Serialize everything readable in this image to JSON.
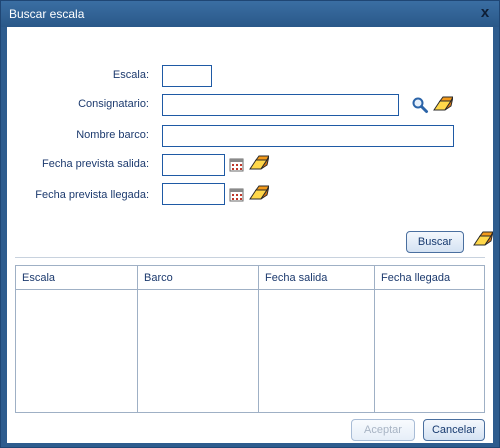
{
  "window": {
    "title": "Buscar escala",
    "close_label": "x"
  },
  "form": {
    "escala_label": "Escala:",
    "escala_value": "",
    "consignatario_label": "Consignatario:",
    "consignatario_value": "",
    "nombre_barco_label": "Nombre barco:",
    "nombre_barco_value": "",
    "fecha_salida_label": "Fecha prevista salida:",
    "fecha_salida_value": "",
    "fecha_llegada_label": "Fecha prevista llegada:",
    "fecha_llegada_value": ""
  },
  "actions": {
    "buscar_label": "Buscar",
    "aceptar_label": "Aceptar",
    "cancelar_label": "Cancelar"
  },
  "results_table": {
    "columns": [
      "Escala",
      "Barco",
      "Fecha salida",
      "Fecha llegada"
    ],
    "rows": []
  },
  "icons": {
    "search": "magnifier-icon",
    "clear": "eraser-icon",
    "calendar": "calendar-icon"
  },
  "colors": {
    "titlebar": "#2e5c8e",
    "accent_border": "#1f5aa5",
    "text": "#1c3a6e"
  }
}
